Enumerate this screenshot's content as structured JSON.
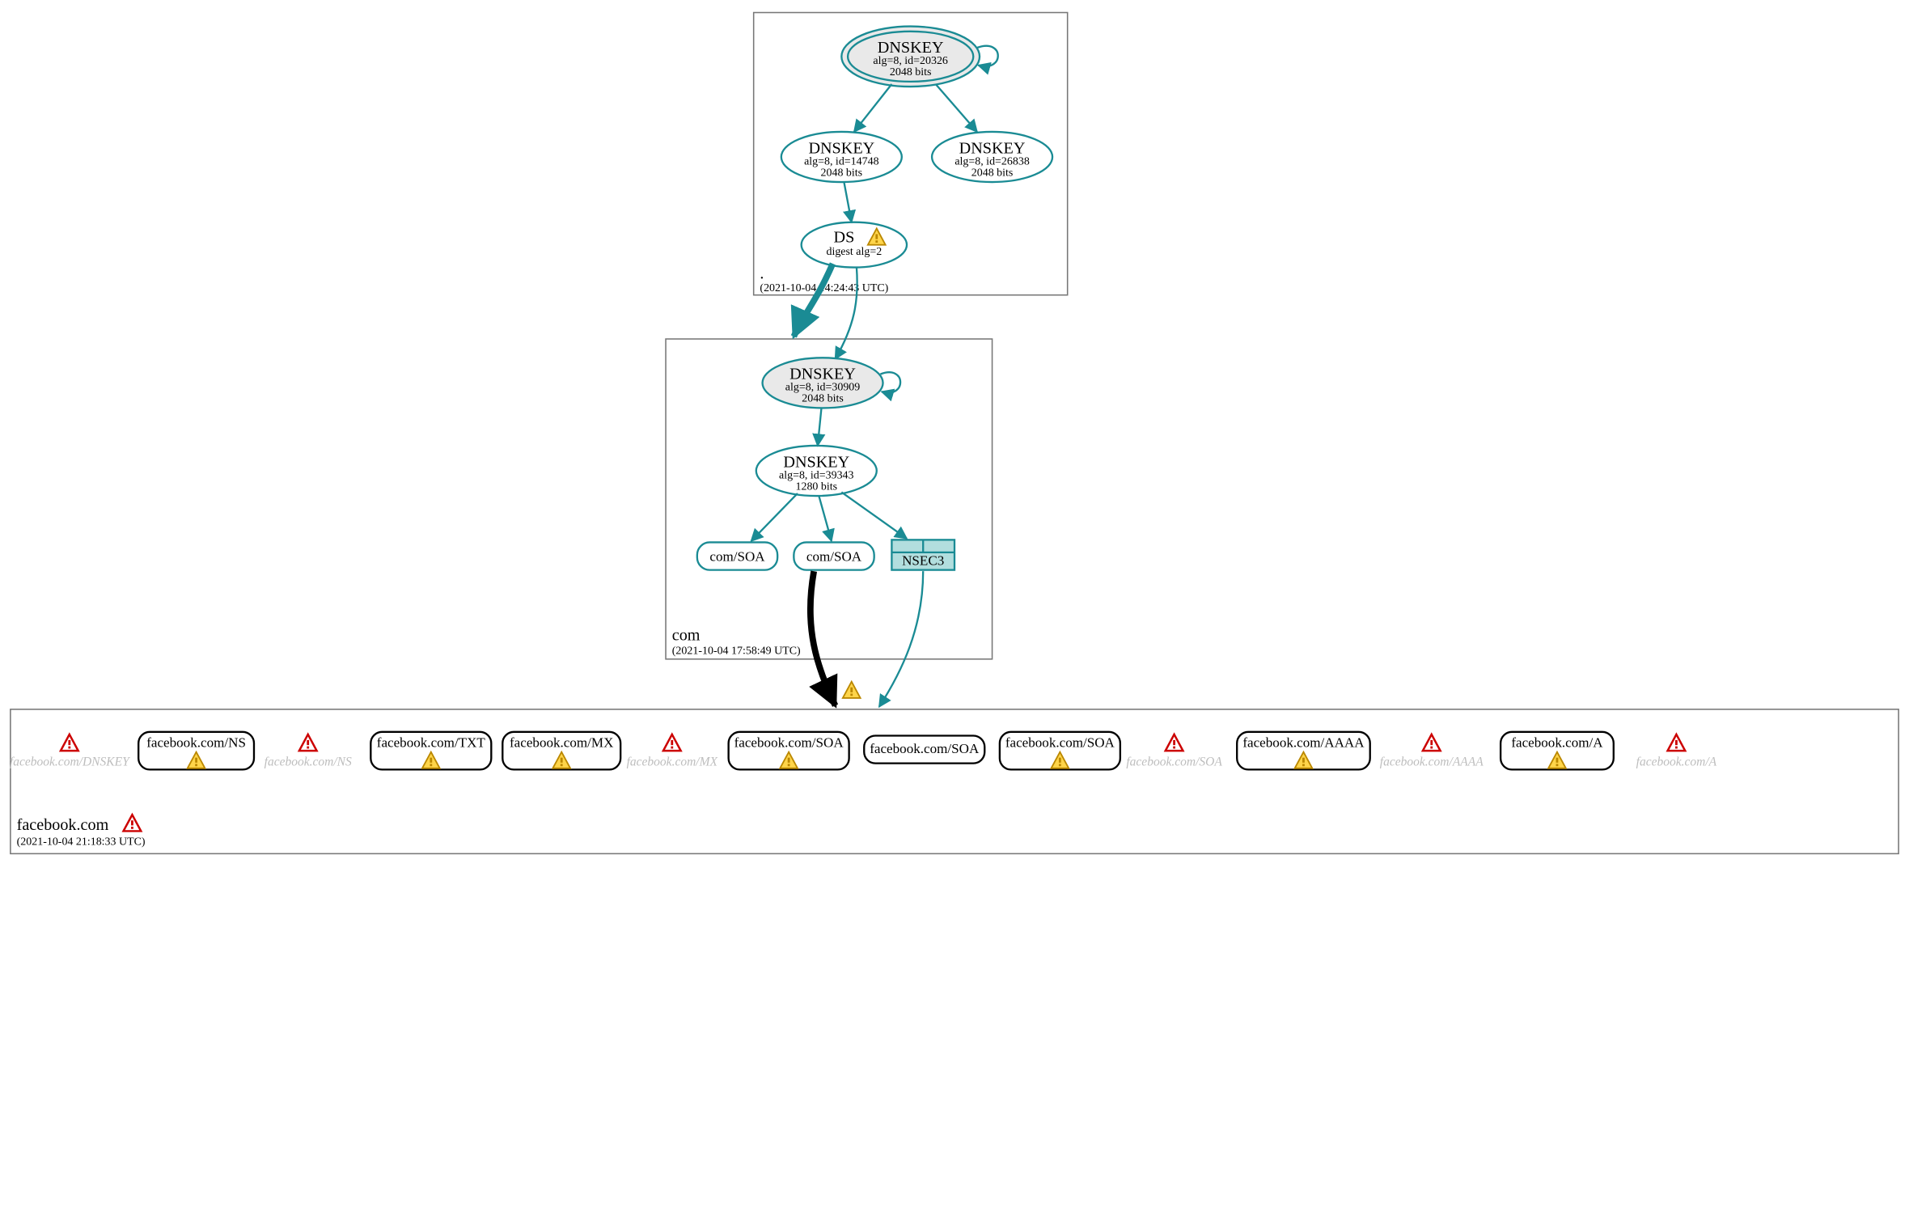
{
  "zones": {
    "root": {
      "label": ".",
      "timestamp": "(2021-10-04 14:24:43 UTC)"
    },
    "com": {
      "label": "com",
      "timestamp": "(2021-10-04 17:58:49 UTC)"
    },
    "fb": {
      "label": "facebook.com",
      "timestamp": "(2021-10-04 21:18:33 UTC)"
    }
  },
  "nodes": {
    "root_ksk": {
      "title": "DNSKEY",
      "l1": "alg=8, id=20326",
      "l2": "2048 bits"
    },
    "root_zsk1": {
      "title": "DNSKEY",
      "l1": "alg=8, id=14748",
      "l2": "2048 bits"
    },
    "root_zsk2": {
      "title": "DNSKEY",
      "l1": "alg=8, id=26838",
      "l2": "2048 bits"
    },
    "root_ds": {
      "title": "DS",
      "l1": "digest alg=2",
      "l2": ""
    },
    "com_ksk": {
      "title": "DNSKEY",
      "l1": "alg=8, id=30909",
      "l2": "2048 bits"
    },
    "com_zsk": {
      "title": "DNSKEY",
      "l1": "alg=8, id=39343",
      "l2": "1280 bits"
    },
    "com_soa1": {
      "label": "com/SOA"
    },
    "com_soa2": {
      "label": "com/SOA"
    },
    "com_nsec3": {
      "label": "NSEC3"
    }
  },
  "leaves": {
    "dnskey": "facebook.com/DNSKEY",
    "ns_r": "facebook.com/NS",
    "ns_f": "facebook.com/NS",
    "txt": "facebook.com/TXT",
    "mx_r": "facebook.com/MX",
    "mx_f": "facebook.com/MX",
    "soa1": "facebook.com/SOA",
    "soa2": "facebook.com/SOA",
    "soa3": "facebook.com/SOA",
    "soa_f": "facebook.com/SOA",
    "aaaa_r": "facebook.com/AAAA",
    "aaaa_f": "facebook.com/AAAA",
    "a_r": "facebook.com/A",
    "a_f": "facebook.com/A"
  }
}
